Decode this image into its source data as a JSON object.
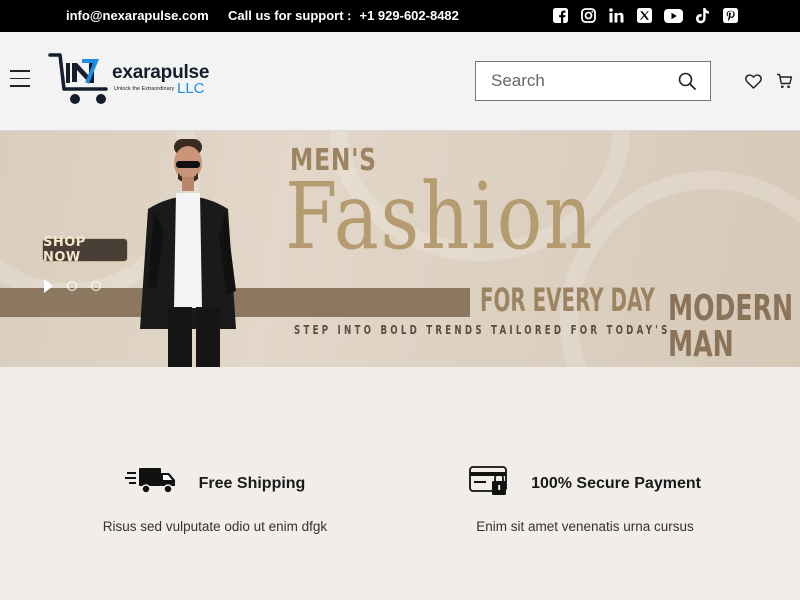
{
  "topbar": {
    "email": "info@nexarapulse.com",
    "support_label": "Call us for support :",
    "phone": "+1 929-602-8482",
    "social": [
      "facebook-icon",
      "instagram-icon",
      "linkedin-icon",
      "x-icon",
      "youtube-icon",
      "tiktok-icon",
      "pinterest-icon"
    ]
  },
  "header": {
    "logo_brand": "exarapulse",
    "logo_tagline": "Unlock the Extraordinary",
    "logo_suffix": "LLC",
    "search_placeholder": "Search"
  },
  "hero": {
    "cta": "SHOP NOW",
    "heading_top": "MEN'S",
    "heading_main": "Fashion",
    "heading_sub": "FOR EVERY DAY",
    "tagline": "STEP INTO BOLD TRENDS TAILORED FOR TODAY'S",
    "side_text_1": "MODERN",
    "side_text_2": "MAN",
    "slides": 2
  },
  "features": [
    {
      "title": "Free Shipping",
      "description": "Risus sed vulputate odio ut enim dfgk",
      "icon": "delivery-truck-icon"
    },
    {
      "title": "100% Secure Payment",
      "description": "Enim sit amet venenatis urna cursus",
      "icon": "secure-card-icon"
    }
  ],
  "colors": {
    "accent": "#1e8fe0",
    "topbar": "#000000",
    "page_bg": "#f1ede9",
    "hero_gold": "#b49b70"
  }
}
